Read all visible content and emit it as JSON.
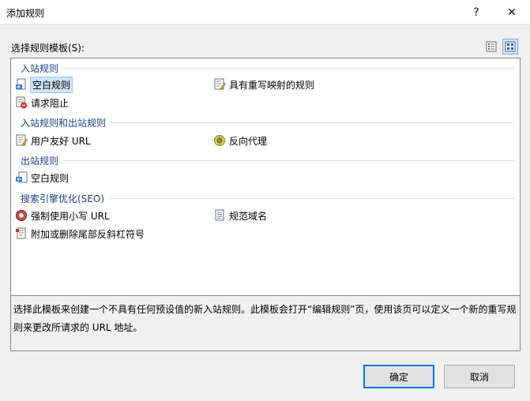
{
  "window": {
    "title": "添加规则",
    "help_glyph": "?",
    "close_glyph": "✕"
  },
  "selector_label": "选择规则模板(S):",
  "groups": [
    {
      "header": "入站规则",
      "items": [
        {
          "label": "空白规则",
          "icon": "blank-rule-icon"
        },
        {
          "label": "具有重写映射的规则",
          "icon": "rewrite-map-icon"
        },
        {
          "label": "请求阻止",
          "icon": "request-block-icon"
        }
      ]
    },
    {
      "header": "入站规则和出站规则",
      "items": [
        {
          "label": "用户友好 URL",
          "icon": "friendly-url-icon"
        },
        {
          "label": "反向代理",
          "icon": "reverse-proxy-icon"
        }
      ]
    },
    {
      "header": "出站规则",
      "items": [
        {
          "label": "空白规则",
          "icon": "outbound-blank-rule-icon"
        }
      ]
    },
    {
      "header": "搜索引擎优化(SEO)",
      "items": [
        {
          "label": "强制使用小写 URL",
          "icon": "lowercase-url-icon"
        },
        {
          "label": "规范域名",
          "icon": "canonical-domain-icon"
        },
        {
          "label": "附加或删除尾部反斜杠符号",
          "icon": "trailing-slash-icon"
        }
      ]
    }
  ],
  "description": "选择此模板来创建一个不具有任何预设值的新入站规则。此模板会打开“编辑规则”页，使用该页可以定义一个新的重写规则来更改所请求的 URL 地址。",
  "buttons": {
    "ok": "确定",
    "cancel": "取消"
  },
  "colors": {
    "group_header": "#1e3f87",
    "selection": "#cce4f7",
    "default_button_border": "#0078d7"
  }
}
